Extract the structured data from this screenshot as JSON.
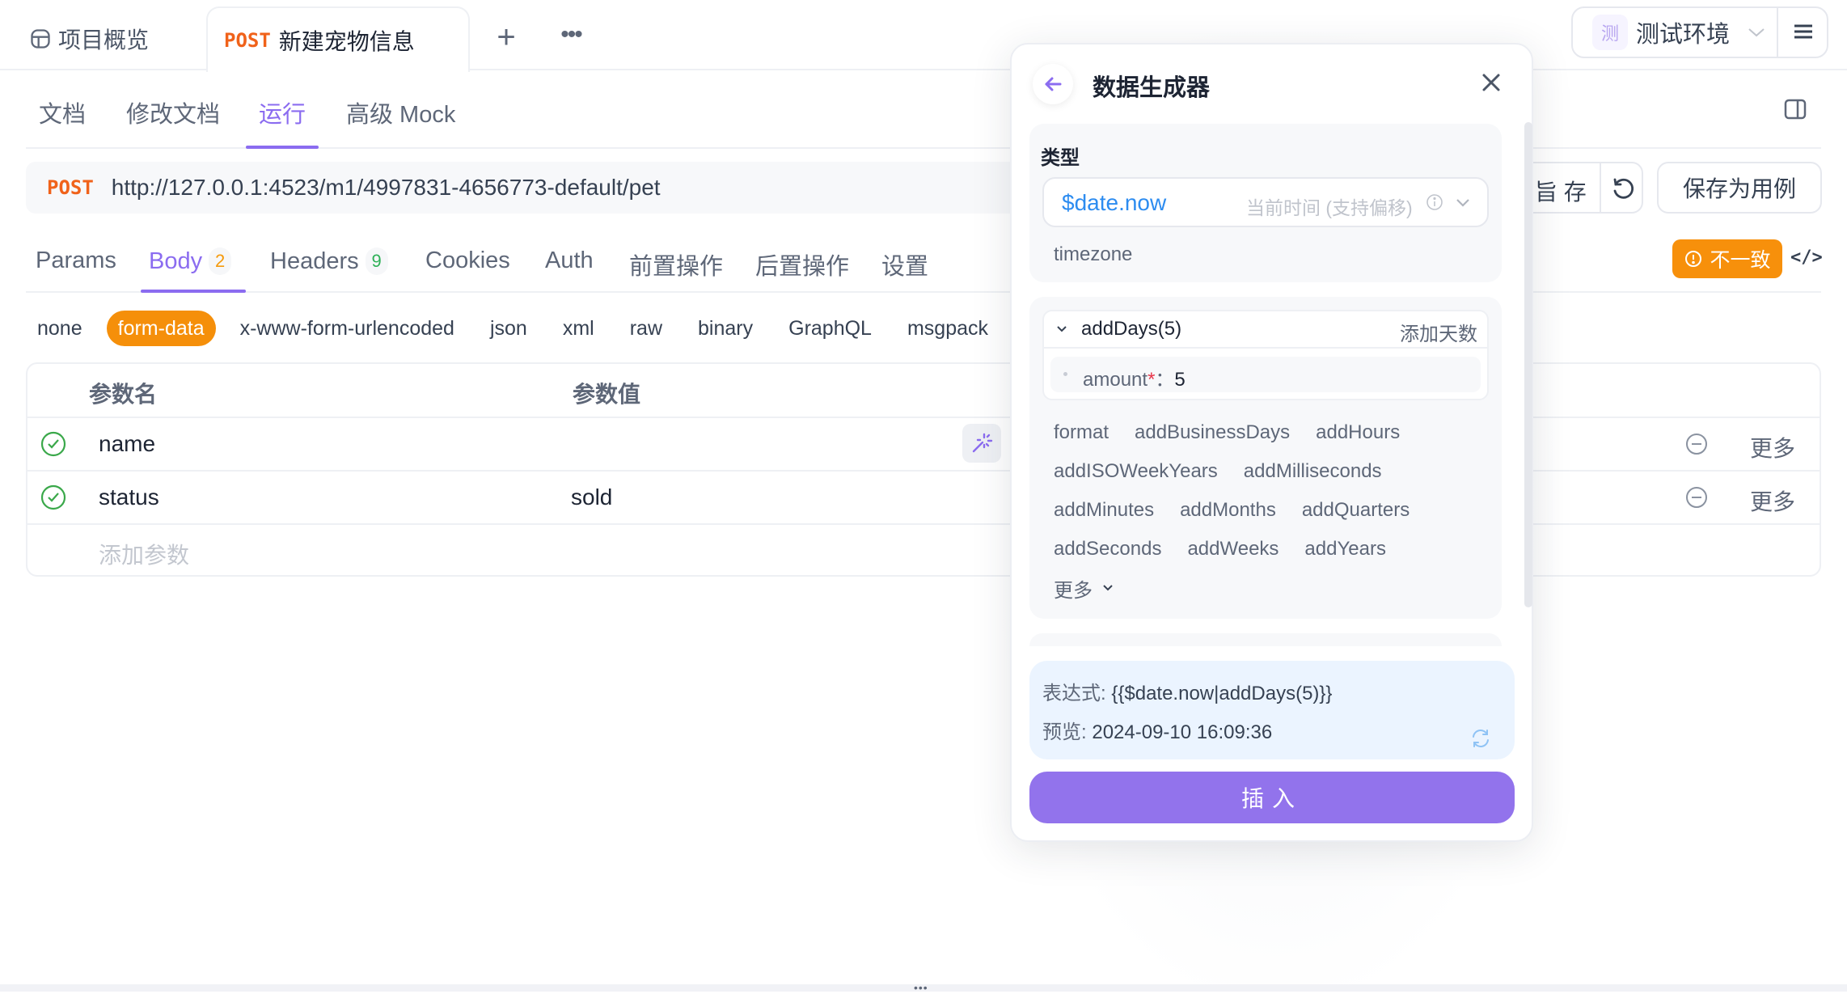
{
  "top_tabs": {
    "overview_label": "项目概览",
    "active_tab": {
      "method": "POST",
      "title": "新建宠物信息"
    },
    "add_label": "+",
    "more_label": "•••"
  },
  "environment": {
    "badge": "测",
    "name": "测试环境"
  },
  "sub_nav": {
    "items": [
      {
        "label": "文档"
      },
      {
        "label": "修改文档"
      },
      {
        "label": "运行",
        "active": true
      },
      {
        "label": "高级 Mock"
      }
    ]
  },
  "request": {
    "method": "POST",
    "url": "http://127.0.0.1:4523/m1/4997831-4656773-default/pet",
    "save_label": "暂 存",
    "save_visible_label": "旨 存",
    "save_case_label": "保存为用例"
  },
  "request_tabs": {
    "items": [
      {
        "label": "Params"
      },
      {
        "label": "Body",
        "count": "2",
        "active": true
      },
      {
        "label": "Headers",
        "count": "9"
      },
      {
        "label": "Cookies"
      },
      {
        "label": "Auth"
      },
      {
        "label": "前置操作"
      },
      {
        "label": "后置操作"
      },
      {
        "label": "设置"
      }
    ],
    "mismatch_label": "不一致",
    "code_label": "</>"
  },
  "body_types": {
    "items": [
      "none",
      "form-data",
      "x-www-form-urlencoded",
      "json",
      "xml",
      "raw",
      "binary",
      "GraphQL",
      "msgpack"
    ],
    "active": "form-data"
  },
  "params_table": {
    "headers": {
      "name": "参数名",
      "value": "参数值"
    },
    "rows": [
      {
        "name": "name",
        "value": "",
        "enabled": true,
        "more": "更多"
      },
      {
        "name": "status",
        "value": "sold",
        "enabled": true,
        "more": "更多"
      }
    ],
    "add_placeholder": "添加参数"
  },
  "data_generator": {
    "title": "数据生成器",
    "type_label": "类型",
    "type_value": "$date.now",
    "type_description": "当前时间 (支持偏移)",
    "timezone_label": "timezone",
    "function": {
      "name": "addDays(5)",
      "description": "添加天数",
      "arg_name": "amount",
      "arg_required_mark": "*",
      "arg_sep": "：",
      "arg_value": "5"
    },
    "methods": [
      [
        "format",
        "addBusinessDays",
        "addHours"
      ],
      [
        "addISOWeekYears",
        "addMilliseconds"
      ],
      [
        "addMinutes",
        "addMonths",
        "addQuarters"
      ],
      [
        "addSeconds",
        "addWeeks",
        "addYears"
      ]
    ],
    "more_label": "更多",
    "expression_label": "表达式: ",
    "expression_value": "{{$date.now|addDays(5)}}",
    "preview_label": "预览: ",
    "preview_value": "2024-09-10 16:09:36",
    "insert_label": "插入"
  },
  "colors": {
    "accent": "#8b6cf0",
    "post_method": "#f0621a",
    "form_data_active": "#f58f0a",
    "mismatch": "#f7900b",
    "insert_button": "#9273ec",
    "type_value": "#2d8cf0",
    "check_green": "#3aa84a"
  }
}
